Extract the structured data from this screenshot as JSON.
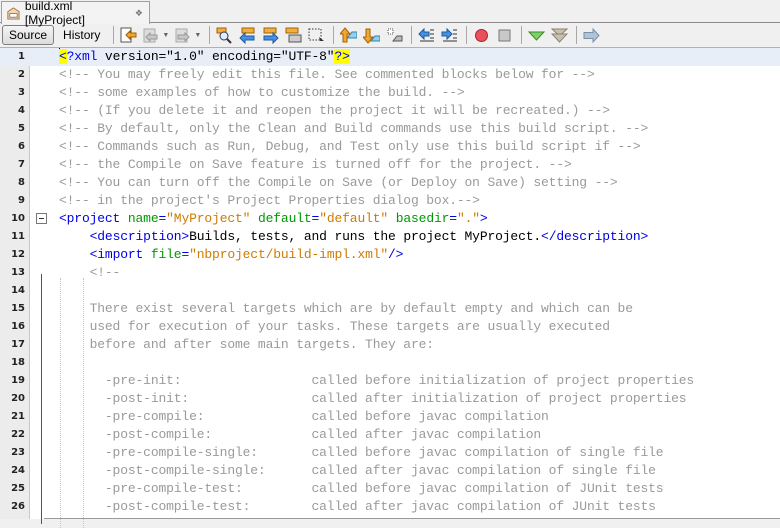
{
  "tab": {
    "title": "build.xml [MyProject]",
    "close_icon": "close-icon"
  },
  "toolbar": {
    "source_label": "Source",
    "history_label": "History",
    "icons": [
      "last-edit-icon",
      "back-icon",
      "forward-icon",
      "find-icon",
      "find-previous-icon",
      "find-next-icon",
      "toggle-highlight-icon",
      "rectangular-selection-icon",
      "previous-bookmark-icon",
      "next-bookmark-icon",
      "toggle-bookmark-icon",
      "shift-left-icon",
      "shift-right-icon",
      "start-macro-icon",
      "stop-macro-icon",
      "comment-icon",
      "uncomment-icon",
      "next-error-icon"
    ]
  },
  "editor": {
    "lines": [
      {
        "n": "1",
        "parts": [
          [
            "hl",
            "<"
          ],
          [
            "tag",
            "?xml"
          ],
          [
            "text",
            " version=\"1.0\" encoding=\"UTF-8\""
          ],
          [
            "hl",
            "?>"
          ]
        ]
      },
      {
        "n": "2",
        "parts": [
          [
            "comment",
            "<!-- You may freely edit this file. See commented blocks below for -->"
          ]
        ]
      },
      {
        "n": "3",
        "parts": [
          [
            "comment",
            "<!-- some examples of how to customize the build. -->"
          ]
        ]
      },
      {
        "n": "4",
        "parts": [
          [
            "comment",
            "<!-- (If you delete it and reopen the project it will be recreated.) -->"
          ]
        ]
      },
      {
        "n": "5",
        "parts": [
          [
            "comment",
            "<!-- By default, only the Clean and Build commands use this build script. -->"
          ]
        ]
      },
      {
        "n": "6",
        "parts": [
          [
            "comment",
            "<!-- Commands such as Run, Debug, and Test only use this build script if -->"
          ]
        ]
      },
      {
        "n": "7",
        "parts": [
          [
            "comment",
            "<!-- the Compile on Save feature is turned off for the project. -->"
          ]
        ]
      },
      {
        "n": "8",
        "parts": [
          [
            "comment",
            "<!-- You can turn off the Compile on Save (or Deploy on Save) setting -->"
          ]
        ]
      },
      {
        "n": "9",
        "parts": [
          [
            "comment",
            "<!-- in the project's Project Properties dialog box.-->"
          ]
        ]
      },
      {
        "n": "10",
        "parts": [
          [
            "tag",
            "<project"
          ],
          [
            "text",
            " "
          ],
          [
            "attr",
            "name"
          ],
          [
            "tag",
            "="
          ],
          [
            "val",
            "\"MyProject\""
          ],
          [
            "text",
            " "
          ],
          [
            "attr",
            "default"
          ],
          [
            "tag",
            "="
          ],
          [
            "val",
            "\"default\""
          ],
          [
            "text",
            " "
          ],
          [
            "attr",
            "basedir"
          ],
          [
            "tag",
            "="
          ],
          [
            "val",
            "\".\""
          ],
          [
            "tag",
            ">"
          ]
        ]
      },
      {
        "n": "11",
        "parts": [
          [
            "text",
            "    "
          ],
          [
            "tag",
            "<description>"
          ],
          [
            "text",
            "Builds, tests, and runs the project MyProject."
          ],
          [
            "tag",
            "</description>"
          ]
        ]
      },
      {
        "n": "12",
        "parts": [
          [
            "text",
            "    "
          ],
          [
            "tag",
            "<import"
          ],
          [
            "text",
            " "
          ],
          [
            "attr",
            "file"
          ],
          [
            "tag",
            "="
          ],
          [
            "val",
            "\"nbproject/build-impl.xml\""
          ],
          [
            "tag",
            "/>"
          ]
        ]
      },
      {
        "n": "13",
        "parts": [
          [
            "comment",
            "    <!--"
          ]
        ]
      },
      {
        "n": "14",
        "parts": []
      },
      {
        "n": "15",
        "parts": [
          [
            "comment",
            "    There exist several targets which are by default empty and which can be"
          ]
        ]
      },
      {
        "n": "16",
        "parts": [
          [
            "comment",
            "    used for execution of your tasks. These targets are usually executed"
          ]
        ]
      },
      {
        "n": "17",
        "parts": [
          [
            "comment",
            "    before and after some main targets. They are:"
          ]
        ]
      },
      {
        "n": "18",
        "parts": []
      },
      {
        "n": "19",
        "parts": [
          [
            "comment",
            "      -pre-init:                 called before initialization of project properties"
          ]
        ]
      },
      {
        "n": "20",
        "parts": [
          [
            "comment",
            "      -post-init:                called after initialization of project properties"
          ]
        ]
      },
      {
        "n": "21",
        "parts": [
          [
            "comment",
            "      -pre-compile:              called before javac compilation"
          ]
        ]
      },
      {
        "n": "22",
        "parts": [
          [
            "comment",
            "      -post-compile:             called after javac compilation"
          ]
        ]
      },
      {
        "n": "23",
        "parts": [
          [
            "comment",
            "      -pre-compile-single:       called before javac compilation of single file"
          ]
        ]
      },
      {
        "n": "24",
        "parts": [
          [
            "comment",
            "      -post-compile-single:      called after javac compilation of single file"
          ]
        ]
      },
      {
        "n": "25",
        "parts": [
          [
            "comment",
            "      -pre-compile-test:         called before javac compilation of JUnit tests"
          ]
        ]
      },
      {
        "n": "26",
        "parts": [
          [
            "comment",
            "      -post-compile-test:        called after javac compilation of JUnit tests"
          ]
        ]
      }
    ]
  }
}
